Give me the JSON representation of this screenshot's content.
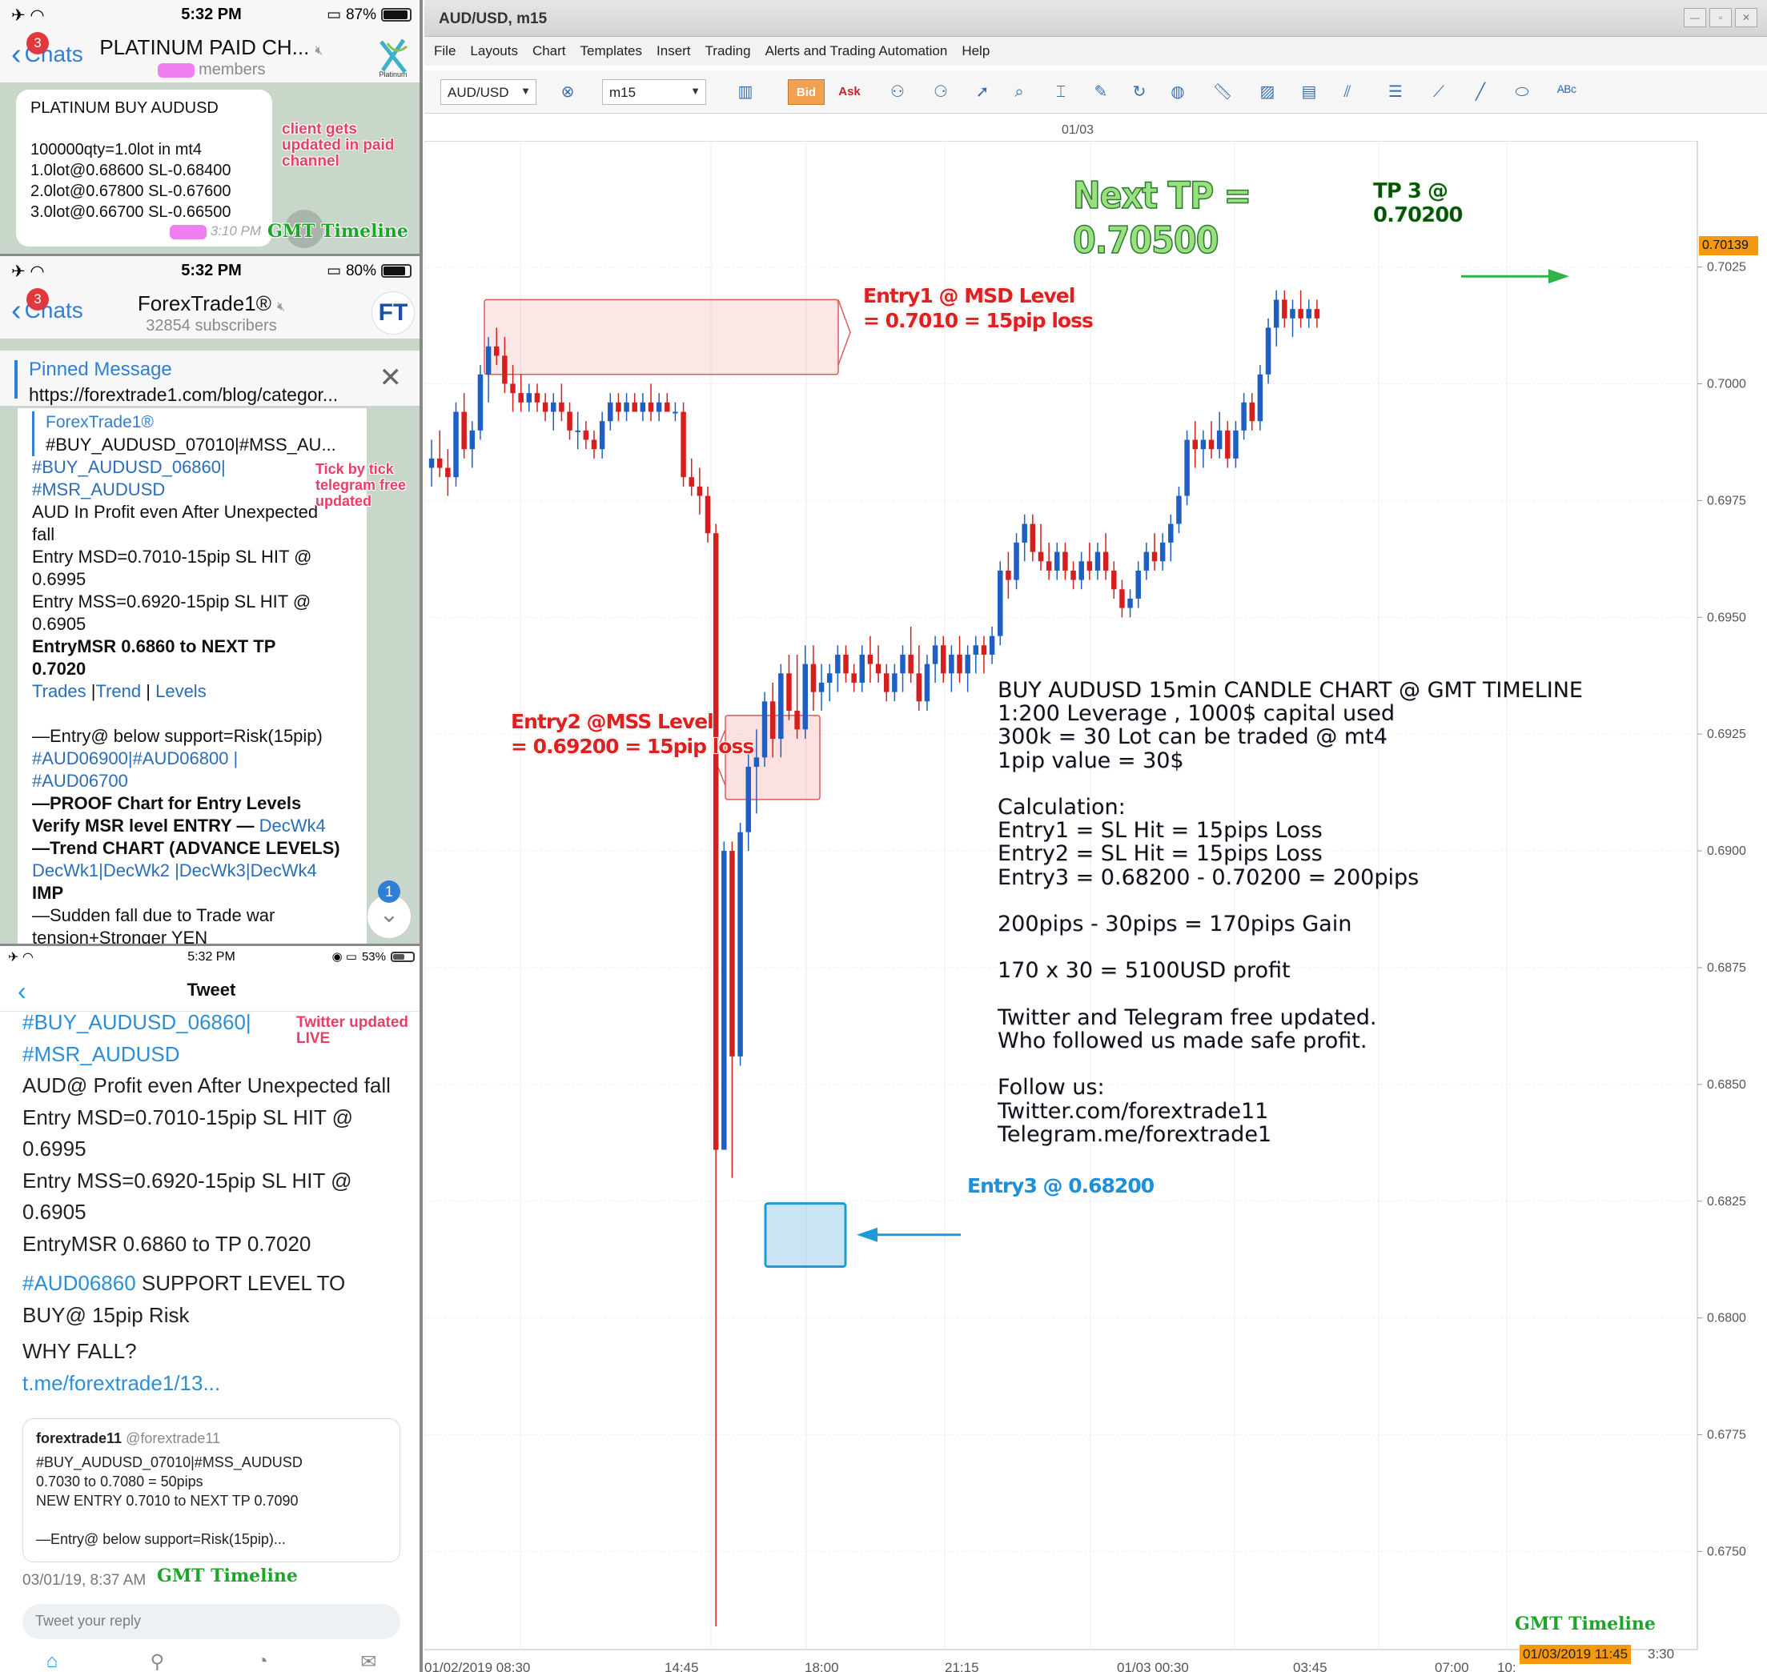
{
  "panel1": {
    "status": {
      "time": "5:32 PM",
      "battery": "87%"
    },
    "back_label": "Chats",
    "badge": "3",
    "title": "PLATINUM PAID CH...",
    "subtitle": "members",
    "message_lines": [
      "PLATINUM BUY AUDUSD",
      "",
      "100000qty=1.0lot in mt4",
      "1.0lot@0.68600 SL-0.68400",
      "2.0lot@0.67800 SL-0.67600",
      "3.0lot@0.66700 SL-0.66500"
    ],
    "message_time": "3:10 PM",
    "annotation": "client gets updated in paid channel",
    "gmt_label": "GMT Timeline",
    "logo_text": "Platinum"
  },
  "panel2": {
    "status": {
      "time": "5:32 PM",
      "battery": "80%"
    },
    "back_label": "Chats",
    "badge": "3",
    "title": "ForexTrade1®",
    "subtitle": "32854 subscribers",
    "avatar_text": "FT",
    "pinned_title": "Pinned Message",
    "pinned_url": "https://forextrade1.com/blog/categor...",
    "fwd_name": "ForexTrade1®",
    "fwd_text": "#BUY_AUDUSD_07010|#MSS_AU...",
    "lines": [
      {
        "t": "#BUY_AUDUSD_06860|",
        "s": "link"
      },
      {
        "t": "#MSR_AUDUSD",
        "s": "link"
      },
      {
        "t": "AUD In Profit even After Unexpected",
        "s": ""
      },
      {
        "t": "fall",
        "s": ""
      },
      {
        "t": "Entry MSD=0.7010-15pip SL HIT @",
        "s": ""
      },
      {
        "t": "0.6995",
        "s": ""
      },
      {
        "t": "Entry MSS=0.6920-15pip SL HIT @",
        "s": ""
      },
      {
        "t": "0.6905",
        "s": ""
      },
      {
        "t": "EntryMSR 0.6860 to NEXT TP",
        "s": "bold"
      },
      {
        "t": "0.7020",
        "s": "bold"
      }
    ],
    "links_row": [
      "Trades",
      "Trend",
      "Levels"
    ],
    "lines2": [
      {
        "t": "—Entry@ below support=Risk(15pip)",
        "s": ""
      },
      {
        "t": "#AUD06900|#AUD06800 |",
        "s": "link"
      },
      {
        "t": "#AUD06700",
        "s": "link"
      },
      {
        "t": "—PROOF Chart for Entry Levels",
        "s": "bold"
      }
    ],
    "verify_text": "Verify MSR level ENTRY — ",
    "verify_link": "DecWk4",
    "trend_text": "—Trend CHART (ADVANCE LEVELS)",
    "dec_links": "DecWk1|DecWk2 |DecWk3|DecWk4",
    "imp": "IMP",
    "tail": [
      "—Sudden fall due to Trade war",
      "tension+Stronger YEN"
    ],
    "annotation": "Tick by tick telegram free updated",
    "scroll_badge": "1"
  },
  "panel3": {
    "status": {
      "time": "5:32 PM",
      "battery": "53%"
    },
    "header": "Tweet",
    "annotation": "Twitter updated LIVE",
    "lines": [
      {
        "t": "#BUY_AUDUSD_06860|",
        "s": "link"
      },
      {
        "t": "#MSR_AUDUSD",
        "s": "link"
      },
      {
        "t": "AUD@ Profit even After Unexpected fall",
        "s": ""
      },
      {
        "t": "Entry MSD=0.7010-15pip SL HIT @",
        "s": ""
      },
      {
        "t": "0.6995",
        "s": ""
      },
      {
        "t": "Entry MSS=0.6920-15pip SL HIT @",
        "s": ""
      },
      {
        "t": "0.6905",
        "s": ""
      },
      {
        "t": "EntryMSR 0.6860 to TP 0.7020",
        "s": ""
      }
    ],
    "support_link": "#AUD06860",
    "support_text": " SUPPORT LEVEL TO",
    "support_text2": "BUY@ 15pip Risk",
    "why": "WHY FALL?",
    "tme": "t.me/forextrade1/13...",
    "quote": {
      "name": "forextrade11",
      "handle": "@forextrade11",
      "lines": [
        "#BUY_AUDUSD_07010|#MSS_AUDUSD",
        "0.7030 to 0.7080 = 50pips",
        "NEW ENTRY 0.7010 to NEXT TP 0.7090",
        "",
        "—Entry@ below support=Risk(15pip)..."
      ]
    },
    "date": "03/01/19, 8:37 AM",
    "gmt_label": "GMT Timeline",
    "reply_placeholder": "Tweet your reply"
  },
  "app": {
    "window_title": "AUD/USD, m15",
    "menu": [
      "File",
      "Layouts",
      "Chart",
      "Templates",
      "Insert",
      "Trading",
      "Alerts and Trading Automation",
      "Help"
    ],
    "symbol": "AUD/USD",
    "timeframe": "m15",
    "bid": "Bid",
    "ask": "Ask",
    "date_marker": "01/03",
    "current_price": "0.70139",
    "time_highlight": "01/03/2019 11:45",
    "time_tail": "3:30",
    "gmt_label": "GMT Timeline"
  },
  "annotations": {
    "next_tp": [
      "Next TP =",
      "0.70500"
    ],
    "tp3": [
      "TP 3 @",
      "0.70200"
    ],
    "entry1": [
      "Entry1 @ MSD Level",
      "= 0.7010 = 15pip loss"
    ],
    "entry2": [
      "Entry2 @MSS Level",
      "= 0.69200 = 15pip loss"
    ],
    "entry3": "Entry3  @ 0.68200",
    "calc_lines": [
      "BUY AUDUSD 15min CANDLE CHART @ GMT TIMELINE",
      "1:200 Leverage , 1000$ capital used",
      "300k = 30 Lot can be traded @ mt4",
      "1pip value = 30$",
      "",
      "Calculation:",
      "Entry1 = SL Hit = 15pips Loss",
      "Entry2 = SL Hit = 15pips Loss",
      "Entry3 = 0.68200 - 0.70200 = 200pips",
      "",
      "200pips - 30pips = 170pips Gain",
      "",
      "170 x 30 = 5100USD profit",
      "",
      "Twitter and Telegram free updated.",
      "Who followed us made safe profit.",
      "",
      "Follow us:",
      "Twitter.com/forextrade11",
      "Telegram.me/forextrade1"
    ]
  },
  "chart_data": {
    "type": "candlestick",
    "series": "AUD/USD m15",
    "price_ticks": [
      "0.7025",
      "0.7000",
      "0.6975",
      "0.6950",
      "0.6925",
      "0.6900",
      "0.6875",
      "0.6850",
      "0.6825",
      "0.6800",
      "0.6775",
      "0.6750"
    ],
    "time_ticks": [
      "01/02/2019 08:30",
      "14:45",
      "18:00",
      "21:15",
      "01/03 00:30",
      "03:45",
      "07:00",
      "10:"
    ],
    "ylim": [
      0.6729,
      0.7052
    ],
    "colors": {
      "up": "#1f5fc4",
      "down": "#d61e1e"
    },
    "candles": [
      [
        0.6982,
        0.6988,
        0.6978,
        0.6984
      ],
      [
        0.6984,
        0.699,
        0.698,
        0.6982
      ],
      [
        0.6982,
        0.6986,
        0.6976,
        0.698
      ],
      [
        0.698,
        0.6996,
        0.6978,
        0.6994
      ],
      [
        0.6994,
        0.6998,
        0.6984,
        0.6986
      ],
      [
        0.6986,
        0.6992,
        0.6982,
        0.699
      ],
      [
        0.699,
        0.7004,
        0.6988,
        0.7002
      ],
      [
        0.7002,
        0.701,
        0.6996,
        0.7008
      ],
      [
        0.7008,
        0.7012,
        0.7004,
        0.7006
      ],
      [
        0.7006,
        0.701,
        0.6998,
        0.7
      ],
      [
        0.7,
        0.7004,
        0.6994,
        0.6998
      ],
      [
        0.6998,
        0.7002,
        0.6994,
        0.6996
      ],
      [
        0.6996,
        0.7,
        0.6994,
        0.6998
      ],
      [
        0.6998,
        0.7,
        0.6994,
        0.6996
      ],
      [
        0.6996,
        0.6998,
        0.6992,
        0.6994
      ],
      [
        0.6994,
        0.6998,
        0.699,
        0.6996
      ],
      [
        0.6996,
        0.7,
        0.6992,
        0.6994
      ],
      [
        0.6994,
        0.6996,
        0.6988,
        0.699
      ],
      [
        0.699,
        0.6994,
        0.6986,
        0.699
      ],
      [
        0.699,
        0.6992,
        0.6986,
        0.6988
      ],
      [
        0.6988,
        0.699,
        0.6984,
        0.6986
      ],
      [
        0.6986,
        0.6994,
        0.6984,
        0.6992
      ],
      [
        0.6992,
        0.6998,
        0.699,
        0.6996
      ],
      [
        0.6996,
        0.6998,
        0.6992,
        0.6994
      ],
      [
        0.6994,
        0.6998,
        0.6992,
        0.6996
      ],
      [
        0.6996,
        0.6998,
        0.6994,
        0.6994
      ],
      [
        0.6994,
        0.6998,
        0.6992,
        0.6996
      ],
      [
        0.6996,
        0.7,
        0.6992,
        0.6994
      ],
      [
        0.6994,
        0.6998,
        0.6992,
        0.6996
      ],
      [
        0.6996,
        0.6998,
        0.6994,
        0.6994
      ],
      [
        0.6994,
        0.6996,
        0.6992,
        0.6994
      ],
      [
        0.6994,
        0.6996,
        0.6978,
        0.698
      ],
      [
        0.698,
        0.6984,
        0.6976,
        0.6978
      ],
      [
        0.6978,
        0.6982,
        0.6972,
        0.6976
      ],
      [
        0.6976,
        0.6978,
        0.6966,
        0.6968
      ],
      [
        0.6968,
        0.697,
        0.6734,
        0.6836
      ],
      [
        0.6836,
        0.6902,
        0.6836,
        0.69
      ],
      [
        0.69,
        0.6902,
        0.683,
        0.6856
      ],
      [
        0.6856,
        0.6906,
        0.6854,
        0.6904
      ],
      [
        0.6904,
        0.6922,
        0.69,
        0.6918
      ],
      [
        0.6918,
        0.6926,
        0.6908,
        0.692
      ],
      [
        0.692,
        0.6934,
        0.6918,
        0.6932
      ],
      [
        0.6932,
        0.6936,
        0.692,
        0.6924
      ],
      [
        0.6924,
        0.694,
        0.692,
        0.6938
      ],
      [
        0.6938,
        0.6942,
        0.6928,
        0.693
      ],
      [
        0.693,
        0.6942,
        0.6924,
        0.6926
      ],
      [
        0.6926,
        0.6944,
        0.6924,
        0.694
      ],
      [
        0.694,
        0.6944,
        0.693,
        0.6934
      ],
      [
        0.6934,
        0.694,
        0.693,
        0.6936
      ],
      [
        0.6936,
        0.694,
        0.6932,
        0.6938
      ],
      [
        0.6938,
        0.6944,
        0.6934,
        0.6942
      ],
      [
        0.6942,
        0.6944,
        0.6936,
        0.6938
      ],
      [
        0.6938,
        0.694,
        0.6934,
        0.6936
      ],
      [
        0.6936,
        0.6944,
        0.6934,
        0.6942
      ],
      [
        0.6942,
        0.6946,
        0.6936,
        0.694
      ],
      [
        0.694,
        0.6944,
        0.6936,
        0.6938
      ],
      [
        0.6938,
        0.694,
        0.6932,
        0.6934
      ],
      [
        0.6934,
        0.694,
        0.6932,
        0.6938
      ],
      [
        0.6938,
        0.6944,
        0.6934,
        0.6942
      ],
      [
        0.6942,
        0.6948,
        0.6936,
        0.6938
      ],
      [
        0.6938,
        0.6944,
        0.693,
        0.6932
      ],
      [
        0.6932,
        0.6942,
        0.693,
        0.694
      ],
      [
        0.694,
        0.6946,
        0.6936,
        0.6944
      ],
      [
        0.6944,
        0.6946,
        0.6936,
        0.6938
      ],
      [
        0.6938,
        0.6944,
        0.6934,
        0.6942
      ],
      [
        0.6942,
        0.6946,
        0.6936,
        0.6938
      ],
      [
        0.6938,
        0.6944,
        0.6934,
        0.6942
      ],
      [
        0.6942,
        0.6946,
        0.6938,
        0.6944
      ],
      [
        0.6944,
        0.6946,
        0.6938,
        0.6942
      ],
      [
        0.6942,
        0.6948,
        0.694,
        0.6946
      ],
      [
        0.6946,
        0.6962,
        0.6944,
        0.696
      ],
      [
        0.696,
        0.6964,
        0.6954,
        0.6958
      ],
      [
        0.6958,
        0.6968,
        0.6956,
        0.6966
      ],
      [
        0.6966,
        0.6972,
        0.6962,
        0.697
      ],
      [
        0.697,
        0.6972,
        0.6962,
        0.6964
      ],
      [
        0.6964,
        0.697,
        0.696,
        0.6962
      ],
      [
        0.6962,
        0.6966,
        0.6958,
        0.696
      ],
      [
        0.696,
        0.6966,
        0.6958,
        0.6964
      ],
      [
        0.6964,
        0.6966,
        0.6958,
        0.696
      ],
      [
        0.696,
        0.6962,
        0.6956,
        0.6958
      ],
      [
        0.6958,
        0.6964,
        0.6956,
        0.6962
      ],
      [
        0.6962,
        0.6966,
        0.6958,
        0.696
      ],
      [
        0.696,
        0.6966,
        0.6958,
        0.6964
      ],
      [
        0.6964,
        0.6968,
        0.6958,
        0.696
      ],
      [
        0.696,
        0.6962,
        0.6954,
        0.6956
      ],
      [
        0.6956,
        0.6958,
        0.695,
        0.6952
      ],
      [
        0.6952,
        0.6956,
        0.695,
        0.6954
      ],
      [
        0.6954,
        0.6962,
        0.6952,
        0.696
      ],
      [
        0.696,
        0.6966,
        0.6958,
        0.6964
      ],
      [
        0.6964,
        0.6968,
        0.696,
        0.6962
      ],
      [
        0.6962,
        0.6968,
        0.696,
        0.6966
      ],
      [
        0.6966,
        0.6972,
        0.6962,
        0.697
      ],
      [
        0.697,
        0.6978,
        0.6968,
        0.6976
      ],
      [
        0.6976,
        0.699,
        0.6974,
        0.6988
      ],
      [
        0.6988,
        0.6992,
        0.6982,
        0.6986
      ],
      [
        0.6986,
        0.699,
        0.6982,
        0.6988
      ],
      [
        0.6988,
        0.6992,
        0.6984,
        0.6986
      ],
      [
        0.6986,
        0.6994,
        0.6984,
        0.699
      ],
      [
        0.699,
        0.6992,
        0.6982,
        0.6984
      ],
      [
        0.6984,
        0.6992,
        0.6982,
        0.699
      ],
      [
        0.699,
        0.6998,
        0.6988,
        0.6996
      ],
      [
        0.6996,
        0.6998,
        0.699,
        0.6992
      ],
      [
        0.6992,
        0.7004,
        0.699,
        0.7002
      ],
      [
        0.7002,
        0.7014,
        0.7,
        0.7012
      ],
      [
        0.7012,
        0.702,
        0.7008,
        0.7018
      ],
      [
        0.7018,
        0.702,
        0.7012,
        0.7014
      ],
      [
        0.7014,
        0.7018,
        0.701,
        0.7016
      ],
      [
        0.7016,
        0.702,
        0.7012,
        0.7014
      ],
      [
        0.7014,
        0.7018,
        0.7012,
        0.7016
      ],
      [
        0.7016,
        0.7018,
        0.7012,
        0.7014
      ]
    ]
  }
}
